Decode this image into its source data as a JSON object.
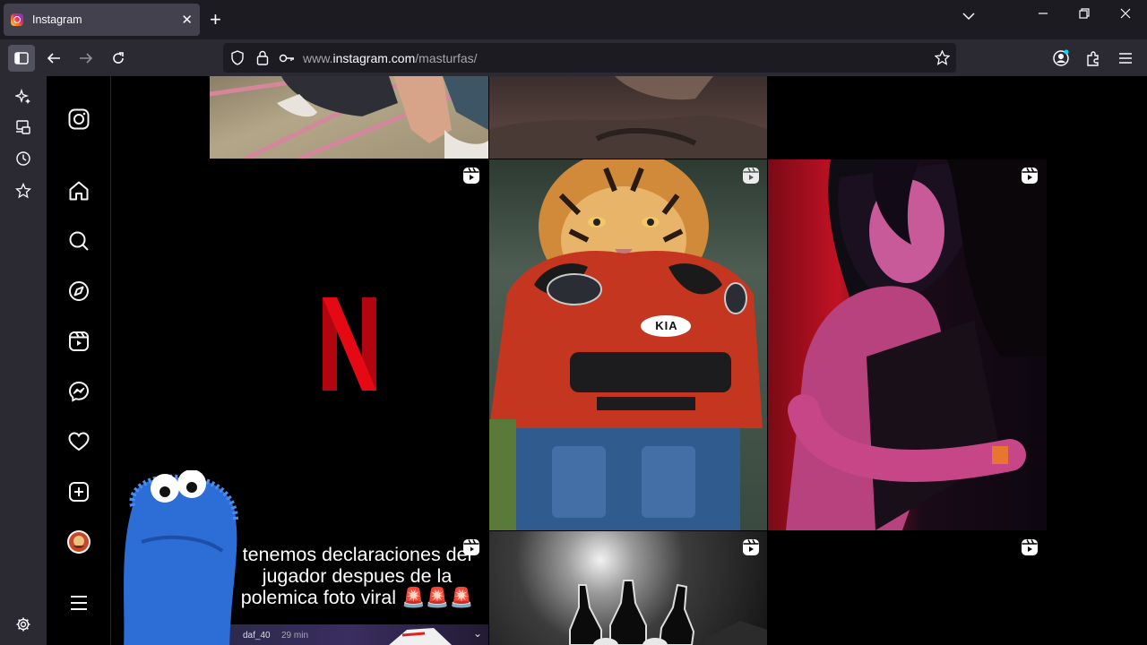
{
  "browser": {
    "tab_title": "Instagram",
    "url_prefix": "www.",
    "url_host": "instagram.com",
    "url_path": "/masturfas/"
  },
  "colors": {
    "netflix_red": "#c4091a",
    "kia_car": "#c4361f",
    "ig_bg": "#000000"
  },
  "grid": {
    "reel_caption": "tenemos declaraciones del jugador despues de la polemica foto viral 🚨🚨🚨",
    "bottom_text": "daf_40",
    "bottom_time": "29 min",
    "car_badge": "KIA"
  }
}
